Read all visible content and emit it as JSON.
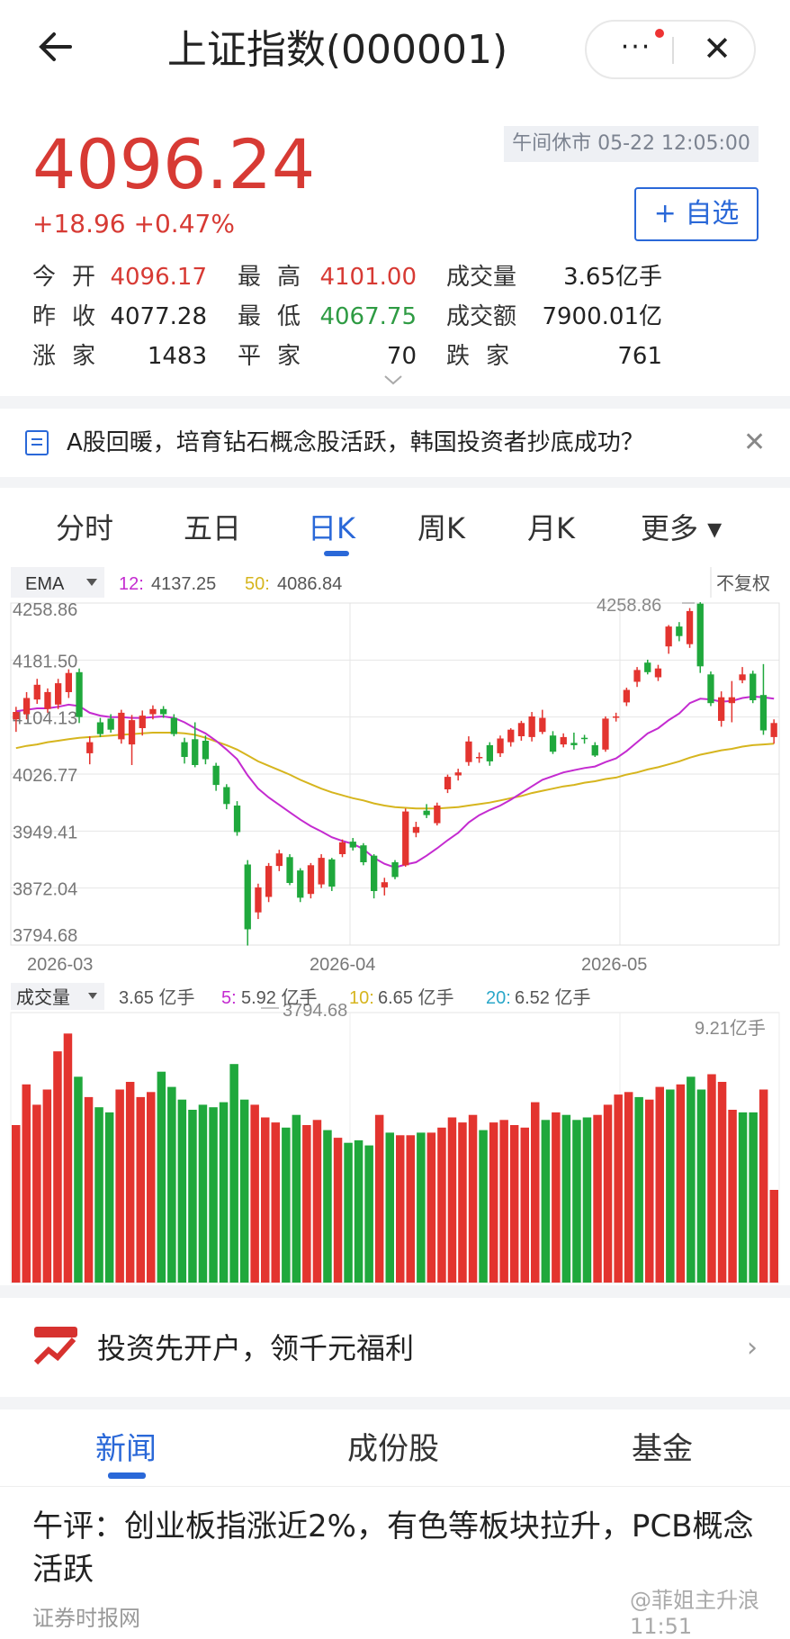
{
  "header": {
    "back_icon": "arrow-left-icon",
    "title": "上证指数(000001)",
    "more_label": "···",
    "close_label": "✕"
  },
  "quote": {
    "price": "4096.24",
    "change": "+18.96",
    "change_pct": "+0.47%",
    "status": "午间休市 05-22 12:05:00",
    "add_label": "+ 自选"
  },
  "stats": [
    [
      {
        "label": "今开",
        "value": "4096.17",
        "color": "red"
      },
      {
        "label": "最高",
        "value": "4101.00",
        "color": "red"
      },
      {
        "label": "成交量",
        "value": "3.65亿手",
        "color": "dark"
      }
    ],
    [
      {
        "label": "昨收",
        "value": "4077.28",
        "color": "dark"
      },
      {
        "label": "最低",
        "value": "4067.75",
        "color": "green"
      },
      {
        "label": "成交额",
        "value": "7900.01亿",
        "color": "dark"
      }
    ],
    [
      {
        "label": "涨家",
        "value": "1483",
        "color": "dark"
      },
      {
        "label": "平家",
        "value": "70",
        "color": "dark"
      },
      {
        "label": "跌家",
        "value": "761",
        "color": "dark"
      }
    ]
  ],
  "news_banner": {
    "text": "A股回暖，培育钻石概念股活跃，韩国投资者抄底成功？",
    "close": "✕"
  },
  "tabs": [
    "分时",
    "五日",
    "日K",
    "周K",
    "月K",
    "更多 ▾"
  ],
  "chart_header": {
    "indicator": "EMA",
    "ema12_label": "12:",
    "ema12_value": "4137.25",
    "ema50_label": "50:",
    "ema50_value": "4086.84",
    "adjust": "不复权"
  },
  "volume_header": {
    "label": "成交量",
    "current": "3.65 亿手",
    "ma5_label": "5:",
    "ma5": "5.92 亿手",
    "ma10_label": "10:",
    "ma10": "6.65 亿手",
    "ma20_label": "20:",
    "ma20": "6.52 亿手",
    "max_label": "9.21亿手"
  },
  "colors": {
    "up": "#e3342f",
    "down": "#1fa83c",
    "ema12": "#c42bd0",
    "ema50": "#d6b51e",
    "accent": "#2a68d8"
  },
  "chart_data": {
    "type": "candlestick",
    "y_ticks": [
      "4258.86",
      "4181.50",
      "4104.13",
      "4026.77",
      "3949.41",
      "3872.04",
      "3794.68"
    ],
    "ylim": [
      3794.68,
      4258.86
    ],
    "x_ticks": [
      "2026-03",
      "2026-04",
      "2026-05"
    ],
    "high_label": "4258.86",
    "low_label": "3794.68",
    "candles": [
      [
        4101,
        4111,
        4084,
        4118
      ],
      [
        4108,
        4130,
        4101,
        4138
      ],
      [
        4128,
        4148,
        4122,
        4156
      ],
      [
        4115,
        4138,
        4110,
        4143
      ],
      [
        4121,
        4150,
        4115,
        4156
      ],
      [
        4138,
        4164,
        4130,
        4169
      ],
      [
        4165,
        4104,
        4096,
        4170
      ],
      [
        4055,
        4070,
        4040,
        4078
      ],
      [
        4097,
        4081,
        4077,
        4103
      ],
      [
        4102,
        4087,
        4083,
        4108
      ],
      [
        4074,
        4110,
        4068,
        4114
      ],
      [
        4067,
        4100,
        4039,
        4107
      ],
      [
        4089,
        4106,
        4079,
        4113
      ],
      [
        4108,
        4115,
        4101,
        4120
      ],
      [
        4115,
        4108,
        4103,
        4119
      ],
      [
        4103,
        4081,
        4078,
        4108
      ],
      [
        4070,
        4050,
        4041,
        4076
      ],
      [
        4074,
        4039,
        4036,
        4097
      ],
      [
        4072,
        4047,
        4040,
        4079
      ],
      [
        4038,
        4012,
        4004,
        4042
      ],
      [
        4009,
        3986,
        3979,
        4013
      ],
      [
        3984,
        3948,
        3943,
        3990
      ],
      [
        3904,
        3816,
        3794,
        3910
      ],
      [
        3839,
        3873,
        3830,
        3878
      ],
      [
        3860,
        3902,
        3853,
        3906
      ],
      [
        3902,
        3919,
        3895,
        3924
      ],
      [
        3914,
        3879,
        3876,
        3918
      ],
      [
        3896,
        3859,
        3853,
        3899
      ],
      [
        3864,
        3903,
        3858,
        3906
      ],
      [
        3877,
        3913,
        3872,
        3918
      ],
      [
        3911,
        3874,
        3868,
        3913
      ],
      [
        3918,
        3934,
        3914,
        3938
      ],
      [
        3935,
        3927,
        3923,
        3940
      ],
      [
        3930,
        3907,
        3903,
        3933
      ],
      [
        3916,
        3868,
        3858,
        3918
      ],
      [
        3873,
        3880,
        3862,
        3886
      ],
      [
        3907,
        3887,
        3884,
        3910
      ],
      [
        3903,
        3976,
        3901,
        3980
      ],
      [
        3947,
        3955,
        3941,
        3962
      ],
      [
        3977,
        3971,
        3967,
        3986
      ],
      [
        3960,
        3984,
        3957,
        3988
      ],
      [
        4006,
        4023,
        4001,
        4026
      ],
      [
        4025,
        4029,
        4018,
        4034
      ],
      [
        4043,
        4071,
        4038,
        4078
      ],
      [
        4049,
        4050,
        4042,
        4056
      ],
      [
        4066,
        4044,
        4038,
        4070
      ],
      [
        4055,
        4075,
        4050,
        4079
      ],
      [
        4070,
        4087,
        4064,
        4089
      ],
      [
        4078,
        4096,
        4072,
        4099
      ],
      [
        4077,
        4105,
        4071,
        4111
      ],
      [
        4084,
        4103,
        4081,
        4114
      ],
      [
        4079,
        4057,
        4054,
        4085
      ],
      [
        4067,
        4077,
        4063,
        4082
      ],
      [
        4069,
        4066,
        4060,
        4083
      ],
      [
        4076,
        4075,
        4068,
        4080
      ],
      [
        4066,
        4052,
        4050,
        4070
      ],
      [
        4060,
        4102,
        4057,
        4105
      ],
      [
        4104,
        4105,
        4098,
        4110
      ],
      [
        4124,
        4141,
        4119,
        4144
      ],
      [
        4152,
        4168,
        4145,
        4172
      ],
      [
        4178,
        4165,
        4162,
        4182
      ],
      [
        4158,
        4170,
        4153,
        4175
      ],
      [
        4200,
        4227,
        4190,
        4229
      ],
      [
        4227,
        4214,
        4207,
        4233
      ],
      [
        4203,
        4248,
        4198,
        4252
      ],
      [
        4258,
        4173,
        4164,
        4260
      ],
      [
        4162,
        4123,
        4119,
        4166
      ],
      [
        4099,
        4131,
        4091,
        4139
      ],
      [
        4123,
        4131,
        4097,
        4153
      ],
      [
        4154,
        4162,
        4150,
        4172
      ],
      [
        4163,
        4127,
        4123,
        4167
      ],
      [
        4134,
        4086,
        4080,
        4176
      ],
      [
        4077,
        4096,
        4068,
        4101
      ]
    ],
    "ema12": [
      4112,
      4114,
      4116,
      4116,
      4118,
      4121,
      4119,
      4110,
      4106,
      4104,
      4104,
      4103,
      4103,
      4104,
      4105,
      4103,
      4097,
      4089,
      4082,
      4072,
      4060,
      4047,
      4025,
      4007,
      3995,
      3985,
      3975,
      3965,
      3956,
      3949,
      3941,
      3936,
      3932,
      3925,
      3913,
      3905,
      3900,
      3904,
      3907,
      3916,
      3926,
      3937,
      3947,
      3961,
      3971,
      3978,
      3984,
      3992,
      4001,
      4010,
      4019,
      4024,
      4029,
      4032,
      4035,
      4037,
      4043,
      4048,
      4058,
      4070,
      4082,
      4089,
      4100,
      4109,
      4123,
      4129,
      4128,
      4125,
      4126,
      4130,
      4132,
      4131,
      4129
    ],
    "ema50": [
      4062,
      4065,
      4067,
      4070,
      4072,
      4074,
      4076,
      4077,
      4078,
      4079,
      4080,
      4081,
      4082,
      4083,
      4083,
      4083,
      4082,
      4080,
      4076,
      4071,
      4066,
      4060,
      4052,
      4044,
      4038,
      4032,
      4026,
      4019,
      4013,
      4007,
      4002,
      3998,
      3994,
      3991,
      3987,
      3984,
      3982,
      3981,
      3980,
      3980,
      3980,
      3981,
      3982,
      3984,
      3986,
      3988,
      3991,
      3994,
      3997,
      4001,
      4004,
      4007,
      4010,
      4012,
      4015,
      4017,
      4020,
      4022,
      4026,
      4029,
      4033,
      4036,
      4040,
      4044,
      4049,
      4053,
      4056,
      4059,
      4061,
      4064,
      4066,
      4067,
      4068
    ],
    "volume": [
      6.2,
      7.8,
      7.0,
      7.6,
      9.1,
      9.8,
      8.1,
      7.3,
      6.9,
      6.7,
      7.6,
      7.9,
      7.3,
      7.5,
      8.3,
      7.7,
      7.2,
      6.8,
      7.0,
      6.9,
      7.1,
      8.6,
      7.2,
      7.0,
      6.5,
      6.3,
      6.1,
      6.6,
      6.2,
      6.4,
      6.0,
      5.7,
      5.5,
      5.6,
      5.4,
      6.6,
      5.9,
      5.8,
      5.8,
      5.9,
      5.9,
      6.1,
      6.5,
      6.3,
      6.6,
      6.0,
      6.3,
      6.4,
      6.2,
      6.1,
      7.1,
      6.4,
      6.7,
      6.6,
      6.4,
      6.5,
      6.6,
      7.0,
      7.4,
      7.5,
      7.3,
      7.2,
      7.7,
      7.6,
      7.8,
      8.1,
      7.6,
      8.2,
      7.9,
      6.8,
      6.7,
      6.7,
      7.6,
      3.65
    ],
    "vol_ylim": [
      0,
      9.21
    ]
  },
  "promo": {
    "text": "投资先开户，领千元福利",
    "arrow": "›"
  },
  "bottom_tabs": [
    "新闻",
    "成份股",
    "基金"
  ],
  "article": {
    "title": "午评：创业板指涨近2%，有色等板块拉升，PCB概念活跃",
    "source": "证券时报网",
    "time": "11:51"
  },
  "watermark": "@菲姐主升浪"
}
